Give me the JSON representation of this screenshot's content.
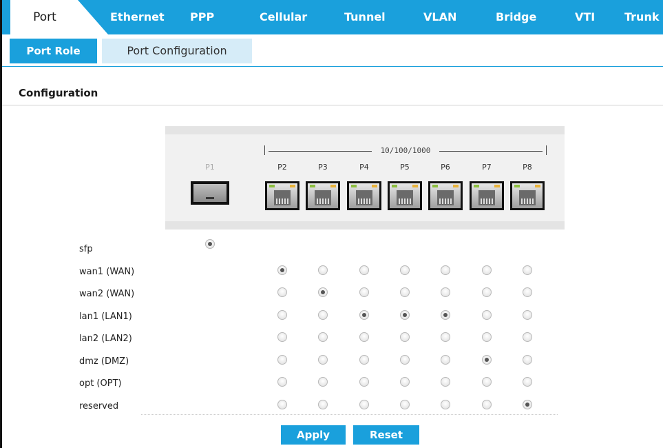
{
  "tabs": [
    "Port",
    "Ethernet",
    "PPP",
    "Cellular",
    "Tunnel",
    "VLAN",
    "Bridge",
    "VTI",
    "Trunk"
  ],
  "active_tab": "Port",
  "subtabs": [
    "Port Role",
    "Port Configuration"
  ],
  "active_subtab": "Port Role",
  "section_title": "Configuration",
  "speed_label": "10/100/1000",
  "ports": [
    "P1",
    "P2",
    "P3",
    "P4",
    "P5",
    "P6",
    "P7",
    "P8"
  ],
  "roles": [
    {
      "label": "sfp",
      "ports": [
        "P1"
      ],
      "selected": [
        "P1"
      ]
    },
    {
      "label": "wan1 (WAN)",
      "ports": [
        "P2",
        "P3",
        "P4",
        "P5",
        "P6",
        "P7",
        "P8"
      ],
      "selected": [
        "P2"
      ]
    },
    {
      "label": "wan2 (WAN)",
      "ports": [
        "P2",
        "P3",
        "P4",
        "P5",
        "P6",
        "P7",
        "P8"
      ],
      "selected": [
        "P3"
      ]
    },
    {
      "label": "lan1 (LAN1)",
      "ports": [
        "P2",
        "P3",
        "P4",
        "P5",
        "P6",
        "P7",
        "P8"
      ],
      "selected": [
        "P4",
        "P5",
        "P6"
      ]
    },
    {
      "label": "lan2 (LAN2)",
      "ports": [
        "P2",
        "P3",
        "P4",
        "P5",
        "P6",
        "P7",
        "P8"
      ],
      "selected": []
    },
    {
      "label": "dmz (DMZ)",
      "ports": [
        "P2",
        "P3",
        "P4",
        "P5",
        "P6",
        "P7",
        "P8"
      ],
      "selected": [
        "P7"
      ]
    },
    {
      "label": "opt (OPT)",
      "ports": [
        "P2",
        "P3",
        "P4",
        "P5",
        "P6",
        "P7",
        "P8"
      ],
      "selected": []
    },
    {
      "label": "reserved",
      "ports": [
        "P2",
        "P3",
        "P4",
        "P5",
        "P6",
        "P7",
        "P8"
      ],
      "selected": [
        "P8"
      ]
    }
  ],
  "buttons": {
    "apply": "Apply",
    "reset": "Reset"
  },
  "colors": {
    "accent": "#1aa0dc",
    "subtab_inactive": "#d6ecf8"
  }
}
